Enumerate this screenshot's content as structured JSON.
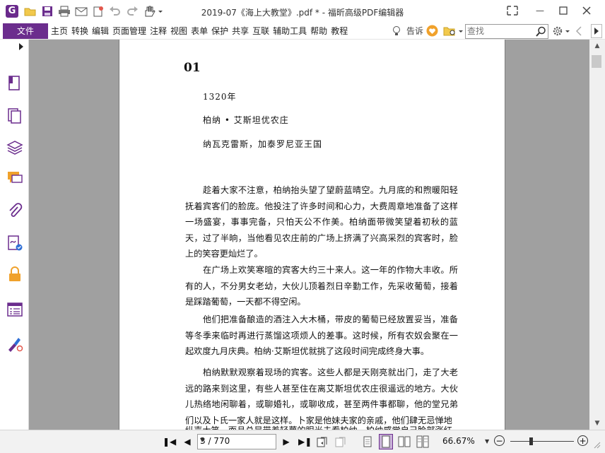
{
  "app": {
    "title": "2019-07《海上大教堂》.pdf * - 福昕高级PDF编辑器",
    "logo_letter": "G",
    "accent_color": "#6b2d8d"
  },
  "quick_access": [
    "open-folder-icon",
    "save-icon",
    "print-icon",
    "email-icon",
    "new-icon",
    "undo-icon",
    "redo-icon",
    "hand-tool-icon"
  ],
  "menu": {
    "file": "文件",
    "items": [
      "主页",
      "转换",
      "编辑",
      "页面管理",
      "注释",
      "视图",
      "表单",
      "保护",
      "共享",
      "互联",
      "辅助工具",
      "帮助",
      "教程"
    ],
    "tell_me": "告诉",
    "search_placeholder": "查找"
  },
  "sidebar": [
    "pages-icon",
    "layers-stack-icon",
    "layers-icon",
    "comments-icon",
    "attachment-icon",
    "signature-icon",
    "lock-icon",
    "form-fields-icon",
    "certify-icon"
  ],
  "document": {
    "chapter": "01",
    "year": "1320年",
    "place1": "柏纳 • 艾斯坦优农庄",
    "place2": "纳瓦克雷斯，加泰罗尼亚王国",
    "paragraphs": [
      "趁着大家不注意，柏纳抬头望了望蔚蓝晴空。九月底的和煦暖阳轻抚着宾客们的脸庞。他投注了许多时间和心力，大费周章地准备了这样一场盛宴，事事完备，只怕天公不作美。柏纳面带微笑望着初秋的蓝天，过了半晌，当他看见农庄前的广场上挤满了兴高采烈的宾客时，脸上的笑容更灿烂了。",
      "在广场上欢笑寒暄的宾客大约三十来人。这一年的作物大丰收。所有的人，不分男女老幼，大伙儿顶着烈日辛勤工作，先采收葡萄，接着是踩踏葡萄，一天都不得空闲。",
      "他们把准备酿造的酒注入大木桶，带皮的葡萄已经放置妥当，准备等冬季来临时再进行蒸馏这项烦人的差事。这时候，所有农奴会聚在一起欢度九月庆典。柏纳·艾斯坦优就挑了这段时间完成终身大事。",
      "柏纳默默观察着现场的宾客。这些人都是天刚亮就出门，走了大老远的路来到这里，有些人甚至住在离艾斯坦优农庄很遥远的地方。大伙儿热络地闲聊着，或聊婚礼，或聊收成，甚至两件事都聊，他的堂兄弟们以及卜氏一家人就是这样。卜家是他妹夫家的亲戚，他们肆无忌惮地",
      "纵声大笑，而且总是带着轻蔑的眼光去看柏纳。柏纳感觉自己脸部涨红"
    ]
  },
  "status": {
    "page_display": "3 / 770",
    "zoom": "66.67%"
  }
}
